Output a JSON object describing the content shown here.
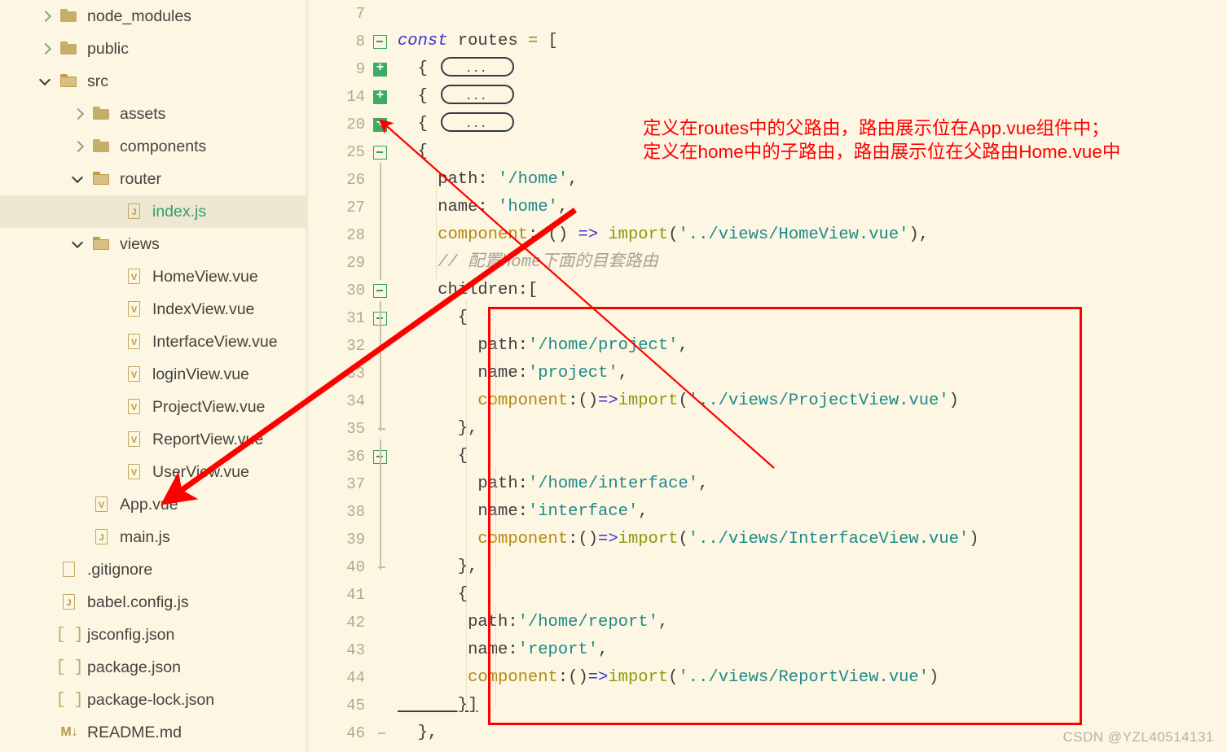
{
  "explorer": {
    "items": [
      {
        "label": "node_modules",
        "icon": "folder-icon",
        "indent": 0,
        "chevron": "collapsed",
        "kind": "folder",
        "selected": false
      },
      {
        "label": "public",
        "icon": "folder-icon",
        "indent": 0,
        "chevron": "collapsed",
        "kind": "folder",
        "selected": false
      },
      {
        "label": "src",
        "icon": "folder-open-icon",
        "indent": 0,
        "chevron": "expanded",
        "kind": "folder-open",
        "selected": false
      },
      {
        "label": "assets",
        "icon": "folder-icon",
        "indent": 1,
        "chevron": "collapsed",
        "kind": "folder",
        "selected": false
      },
      {
        "label": "components",
        "icon": "folder-icon",
        "indent": 1,
        "chevron": "collapsed",
        "kind": "folder",
        "selected": false
      },
      {
        "label": "router",
        "icon": "folder-open-icon",
        "indent": 1,
        "chevron": "expanded",
        "kind": "folder-open",
        "selected": false
      },
      {
        "label": "index.js",
        "icon": "js-file-icon",
        "indent": 2,
        "chevron": "none",
        "kind": "js",
        "selected": true
      },
      {
        "label": "views",
        "icon": "folder-open-icon",
        "indent": 1,
        "chevron": "expanded",
        "kind": "folder-open",
        "selected": false
      },
      {
        "label": "HomeView.vue",
        "icon": "vue-file-icon",
        "indent": 2,
        "chevron": "none",
        "kind": "vue",
        "selected": false
      },
      {
        "label": "IndexView.vue",
        "icon": "vue-file-icon",
        "indent": 2,
        "chevron": "none",
        "kind": "vue",
        "selected": false
      },
      {
        "label": "InterfaceView.vue",
        "icon": "vue-file-icon",
        "indent": 2,
        "chevron": "none",
        "kind": "vue",
        "selected": false
      },
      {
        "label": "loginView.vue",
        "icon": "vue-file-icon",
        "indent": 2,
        "chevron": "none",
        "kind": "vue",
        "selected": false
      },
      {
        "label": "ProjectView.vue",
        "icon": "vue-file-icon",
        "indent": 2,
        "chevron": "none",
        "kind": "vue",
        "selected": false
      },
      {
        "label": "ReportView.vue",
        "icon": "vue-file-icon",
        "indent": 2,
        "chevron": "none",
        "kind": "vue",
        "selected": false
      },
      {
        "label": "UserView.vue",
        "icon": "vue-file-icon",
        "indent": 2,
        "chevron": "none",
        "kind": "vue",
        "selected": false
      },
      {
        "label": "App.vue",
        "icon": "vue-file-icon",
        "indent": 1,
        "chevron": "none",
        "kind": "vue",
        "selected": false
      },
      {
        "label": "main.js",
        "icon": "js-file-icon",
        "indent": 1,
        "chevron": "none",
        "kind": "js",
        "selected": false
      },
      {
        "label": ".gitignore",
        "icon": "blank-file-icon",
        "indent": 0,
        "chevron": "none",
        "kind": "blank",
        "selected": false
      },
      {
        "label": "babel.config.js",
        "icon": "js-file-icon",
        "indent": 0,
        "chevron": "none",
        "kind": "js",
        "selected": false
      },
      {
        "label": "jsconfig.json",
        "icon": "json-file-icon",
        "indent": 0,
        "chevron": "none",
        "kind": "json",
        "selected": false
      },
      {
        "label": "package.json",
        "icon": "json-file-icon",
        "indent": 0,
        "chevron": "none",
        "kind": "json",
        "selected": false
      },
      {
        "label": "package-lock.json",
        "icon": "json-file-icon",
        "indent": 0,
        "chevron": "none",
        "kind": "json",
        "selected": false
      },
      {
        "label": "README.md",
        "icon": "markdown-file-icon",
        "indent": 0,
        "chevron": "none",
        "kind": "md",
        "selected": false
      }
    ]
  },
  "editor": {
    "lines": [
      {
        "no": "7",
        "fold": "none",
        "gutter": "none",
        "indent": 0,
        "tokens": []
      },
      {
        "no": "8",
        "fold": "minus",
        "gutter": "none",
        "indent": 0,
        "tokens": [
          {
            "t": "const",
            "c": "t-kw"
          },
          {
            "t": " routes ",
            "c": "t-plain"
          },
          {
            "t": "=",
            "c": "t-op"
          },
          {
            "t": " [",
            "c": "t-br"
          }
        ]
      },
      {
        "no": "9",
        "fold": "plus",
        "gutter": "none",
        "indent": 0,
        "tokens": [
          {
            "t": "  { ",
            "c": "t-br"
          }
        ],
        "widget": "..."
      },
      {
        "no": "14",
        "fold": "plus",
        "gutter": "none",
        "indent": 0,
        "tokens": [
          {
            "t": "  { ",
            "c": "t-br"
          }
        ],
        "widget": "..."
      },
      {
        "no": "20",
        "fold": "plus",
        "gutter": "none",
        "indent": 0,
        "tokens": [
          {
            "t": "  { ",
            "c": "t-br"
          }
        ],
        "widget": "..."
      },
      {
        "no": "25",
        "fold": "minus",
        "gutter": "none",
        "indent": 0,
        "tokens": [
          {
            "t": "  {",
            "c": "t-br"
          }
        ]
      },
      {
        "no": "26",
        "fold": "none",
        "gutter": "bar",
        "indent": 0,
        "tokens": [
          {
            "t": "    path",
            "c": "t-plain"
          },
          {
            "t": ": ",
            "c": "t-plain"
          },
          {
            "t": "'/home'",
            "c": "t-str"
          },
          {
            "t": ",",
            "c": "t-plain"
          }
        ]
      },
      {
        "no": "27",
        "fold": "none",
        "gutter": "bar",
        "indent": 0,
        "tokens": [
          {
            "t": "    name",
            "c": "t-plain"
          },
          {
            "t": ": ",
            "c": "t-plain"
          },
          {
            "t": "'home'",
            "c": "t-str"
          },
          {
            "t": ",",
            "c": "t-plain"
          }
        ]
      },
      {
        "no": "28",
        "fold": "none",
        "gutter": "bar",
        "indent": 0,
        "tokens": [
          {
            "t": "    component",
            "c": "t-prop"
          },
          {
            "t": ": () ",
            "c": "t-plain"
          },
          {
            "t": "=>",
            "c": "t-arrow"
          },
          {
            "t": " ",
            "c": "t-plain"
          },
          {
            "t": "import",
            "c": "t-fn"
          },
          {
            "t": "(",
            "c": "t-plain"
          },
          {
            "t": "'../views/HomeView.vue'",
            "c": "t-str"
          },
          {
            "t": "),",
            "c": "t-plain"
          }
        ]
      },
      {
        "no": "29",
        "fold": "none",
        "gutter": "bar",
        "indent": 0,
        "tokens": [
          {
            "t": "    // 配置home下面的目套路由",
            "c": "t-cmt"
          }
        ]
      },
      {
        "no": "30",
        "fold": "minus",
        "gutter": "none",
        "indent": 0,
        "tokens": [
          {
            "t": "    children:[",
            "c": "t-plain"
          }
        ]
      },
      {
        "no": "31",
        "fold": "minus",
        "gutter": "none",
        "indent": 0,
        "tokens": [
          {
            "t": "      {",
            "c": "t-br"
          }
        ]
      },
      {
        "no": "32",
        "fold": "none",
        "gutter": "bar",
        "indent": 0,
        "tokens": [
          {
            "t": "        path",
            "c": "t-plain"
          },
          {
            "t": ":",
            "c": "t-plain"
          },
          {
            "t": "'/home/project'",
            "c": "t-str"
          },
          {
            "t": ",",
            "c": "t-plain"
          }
        ]
      },
      {
        "no": "33",
        "fold": "none",
        "gutter": "bar",
        "indent": 0,
        "tokens": [
          {
            "t": "        name",
            "c": "t-plain"
          },
          {
            "t": ":",
            "c": "t-plain"
          },
          {
            "t": "'project'",
            "c": "t-str"
          },
          {
            "t": ",",
            "c": "t-plain"
          }
        ]
      },
      {
        "no": "34",
        "fold": "none",
        "gutter": "bar",
        "indent": 0,
        "tokens": [
          {
            "t": "        component",
            "c": "t-prop"
          },
          {
            "t": ":()",
            "c": "t-plain"
          },
          {
            "t": "=>",
            "c": "t-arrow"
          },
          {
            "t": "import",
            "c": "t-fn"
          },
          {
            "t": "(",
            "c": "t-plain"
          },
          {
            "t": "'../views/ProjectView.vue'",
            "c": "t-str"
          },
          {
            "t": ")",
            "c": "t-plain"
          }
        ]
      },
      {
        "no": "35",
        "fold": "none",
        "gutter": "tick",
        "indent": 0,
        "tokens": [
          {
            "t": "      },",
            "c": "t-br"
          }
        ]
      },
      {
        "no": "36",
        "fold": "minus",
        "gutter": "none",
        "indent": 0,
        "tokens": [
          {
            "t": "      {",
            "c": "t-br"
          }
        ]
      },
      {
        "no": "37",
        "fold": "none",
        "gutter": "bar",
        "indent": 0,
        "tokens": [
          {
            "t": "        path",
            "c": "t-plain"
          },
          {
            "t": ":",
            "c": "t-plain"
          },
          {
            "t": "'/home/interface'",
            "c": "t-str"
          },
          {
            "t": ",",
            "c": "t-plain"
          }
        ]
      },
      {
        "no": "38",
        "fold": "none",
        "gutter": "bar",
        "indent": 0,
        "tokens": [
          {
            "t": "        name",
            "c": "t-plain"
          },
          {
            "t": ":",
            "c": "t-plain"
          },
          {
            "t": "'interface'",
            "c": "t-str"
          },
          {
            "t": ",",
            "c": "t-plain"
          }
        ]
      },
      {
        "no": "39",
        "fold": "none",
        "gutter": "bar",
        "indent": 0,
        "tokens": [
          {
            "t": "        component",
            "c": "t-prop"
          },
          {
            "t": ":()",
            "c": "t-plain"
          },
          {
            "t": "=>",
            "c": "t-arrow"
          },
          {
            "t": "import",
            "c": "t-fn"
          },
          {
            "t": "(",
            "c": "t-plain"
          },
          {
            "t": "'../views/InterfaceView.vue'",
            "c": "t-str"
          },
          {
            "t": ")",
            "c": "t-plain"
          }
        ]
      },
      {
        "no": "40",
        "fold": "none",
        "gutter": "tick",
        "indent": 0,
        "tokens": [
          {
            "t": "      },",
            "c": "t-br"
          }
        ]
      },
      {
        "no": "41",
        "fold": "none",
        "gutter": "none",
        "indent": 0,
        "tokens": [
          {
            "t": "      {",
            "c": "t-br"
          }
        ]
      },
      {
        "no": "42",
        "fold": "none",
        "gutter": "bar",
        "indent": 0,
        "tokens": [
          {
            "t": "       path",
            "c": "t-plain"
          },
          {
            "t": ":",
            "c": "t-plain"
          },
          {
            "t": "'/home/report'",
            "c": "t-str"
          },
          {
            "t": ",",
            "c": "t-plain"
          }
        ]
      },
      {
        "no": "43",
        "fold": "none",
        "gutter": "bar",
        "indent": 0,
        "tokens": [
          {
            "t": "       name",
            "c": "t-plain"
          },
          {
            "t": ":",
            "c": "t-plain"
          },
          {
            "t": "'report'",
            "c": "t-str"
          },
          {
            "t": ",",
            "c": "t-plain"
          }
        ]
      },
      {
        "no": "44",
        "fold": "none",
        "gutter": "bar",
        "indent": 0,
        "tokens": [
          {
            "t": "       component",
            "c": "t-prop"
          },
          {
            "t": ":()",
            "c": "t-plain"
          },
          {
            "t": "=>",
            "c": "t-arrow"
          },
          {
            "t": "import",
            "c": "t-fn"
          },
          {
            "t": "(",
            "c": "t-plain"
          },
          {
            "t": "'../views/ReportView.vue'",
            "c": "t-str"
          },
          {
            "t": ")",
            "c": "t-plain"
          }
        ]
      },
      {
        "no": "45",
        "fold": "none",
        "gutter": "bar",
        "indent": 0,
        "tokens": [
          {
            "t": "      }]",
            "c": "t-br underl"
          }
        ]
      },
      {
        "no": "46",
        "fold": "none",
        "gutter": "tick",
        "indent": 0,
        "tokens": [
          {
            "t": "  },",
            "c": "t-br"
          }
        ]
      }
    ]
  },
  "annotation": {
    "line1": "定义在routes中的父路由，路由展示位在App.vue组件中；",
    "line2": "定义在home中的子路由，路由展示位在父路由Home.vue中",
    "color": "#ff0000"
  },
  "watermark": "CSDN @YZL40514131"
}
